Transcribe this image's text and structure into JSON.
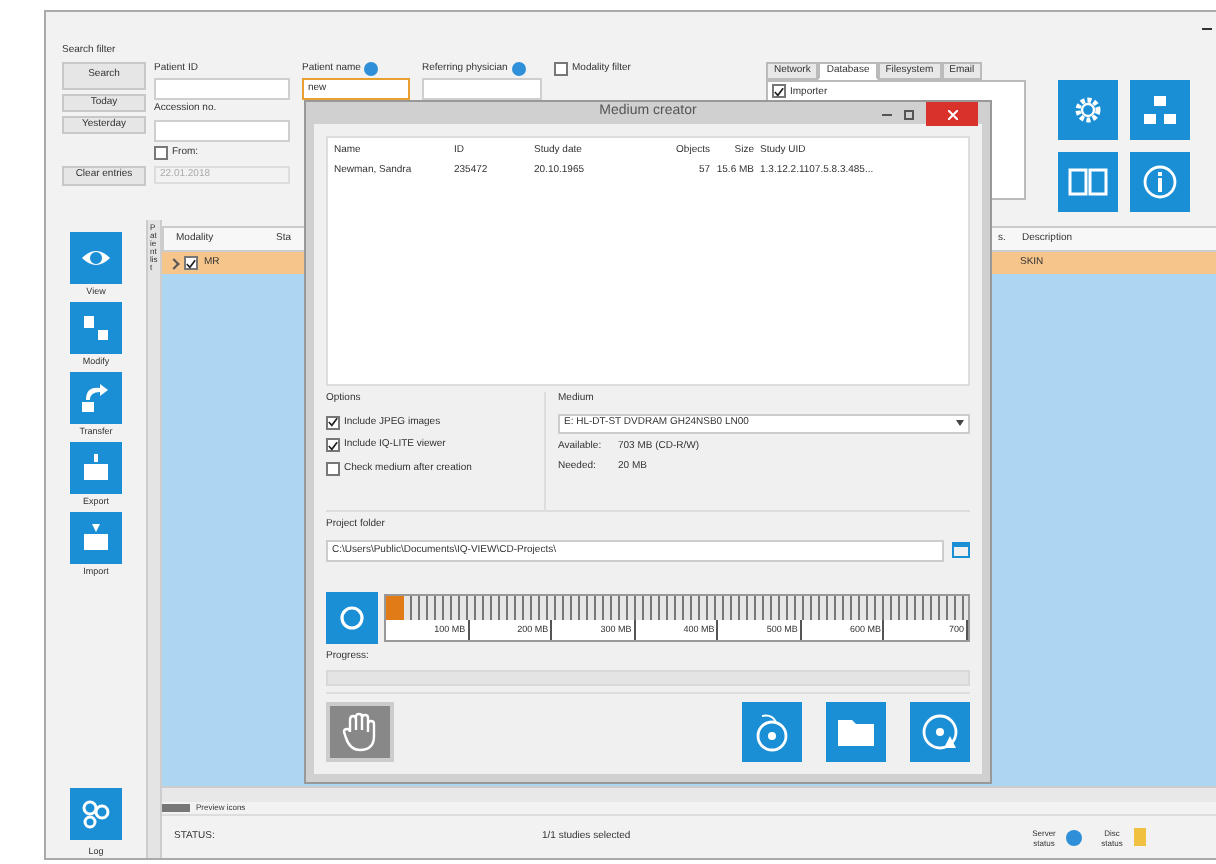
{
  "search_filter": {
    "title": "Search filter",
    "buttons": [
      "Search",
      "Today",
      "Yesterday",
      "Clear entries"
    ],
    "patient_id": {
      "label": "Patient ID"
    },
    "patient_name": {
      "label": "Patient name",
      "value": "new"
    },
    "referring_physician": {
      "label": "Referring physician"
    },
    "modality_filter": {
      "label": "Modality filter",
      "checked": false
    },
    "accession": {
      "label": "Accession no."
    },
    "from": {
      "label": "From:",
      "checked": false
    },
    "date": {
      "value": "22.01.2018"
    }
  },
  "tabs": [
    {
      "label": "Network",
      "selected": false
    },
    {
      "label": "Database",
      "selected": true
    },
    {
      "label": "Filesystem",
      "selected": false
    },
    {
      "label": "Email",
      "selected": false
    }
  ],
  "tab_content": {
    "label": "Importer",
    "checked": true
  },
  "sidebar": {
    "items": [
      {
        "label": "View"
      },
      {
        "label": "Modify"
      },
      {
        "label": "Transfer"
      },
      {
        "label": "Export"
      },
      {
        "label": "Import"
      }
    ],
    "log": "Log"
  },
  "side_tab": "Patient list",
  "grid": {
    "columns": [
      "Modality",
      "Sta",
      "s.",
      "Description"
    ],
    "rows": [
      {
        "modality": "MR",
        "checked": true,
        "expanded": false,
        "description": "SKIN",
        "selected": true
      }
    ]
  },
  "preview_label": "Preview icons",
  "status_bar": {
    "status": "STATUS:",
    "selection": "1/1 studies selected",
    "server": "Server status",
    "disc": "Disc status"
  },
  "dialog": {
    "title": "Medium creator",
    "columns": [
      "Name",
      "ID",
      "Study date",
      "Objects",
      "Size",
      "Study UID"
    ],
    "rows": [
      {
        "cells": [
          "Newman, Sandra",
          "235472",
          "20.10.1965",
          "57",
          "15.6 MB",
          "1.3.12.2.1107.5.8.3.485..."
        ]
      }
    ],
    "options": {
      "title": "Options",
      "items": [
        {
          "label": "Include JPEG images",
          "checked": true
        },
        {
          "label": "Include IQ-LITE viewer",
          "checked": true
        },
        {
          "label": "Check medium after creation",
          "checked": false
        }
      ]
    },
    "medium": {
      "title": "Medium",
      "drive": "E: HL-DT-ST DVDRAM GH24NSB0 LN00",
      "available_label": "Available:",
      "available": "703 MB (CD-R/W)",
      "needed_label": "Needed:",
      "needed": "20 MB"
    },
    "project_folder": {
      "label": "Project folder",
      "path": "C:\\Users\\Public\\Documents\\IQ-VIEW\\CD-Projects\\"
    },
    "capacity": {
      "level": 0.03,
      "ticks": [
        "100 MB",
        "200 MB",
        "300 MB",
        "400 MB",
        "500 MB",
        "600 MB",
        "700"
      ]
    },
    "progress": {
      "label": "Progress:",
      "level": 0
    }
  }
}
